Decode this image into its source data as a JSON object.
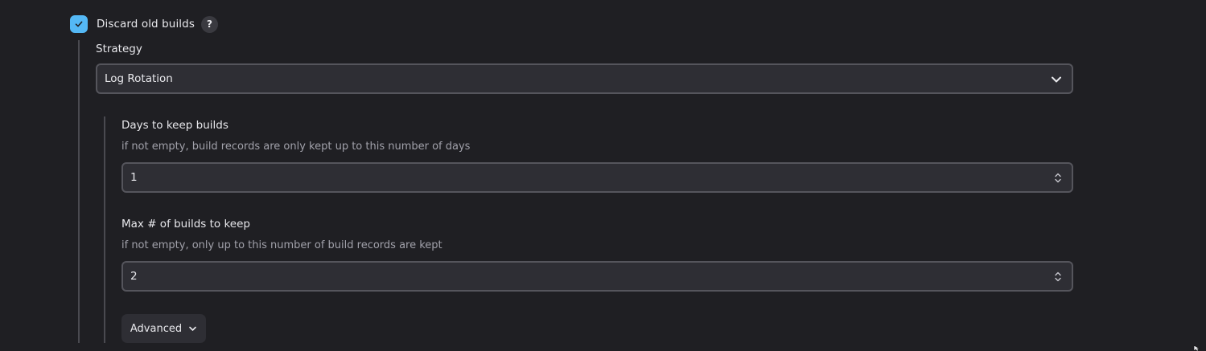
{
  "discard_old_builds": {
    "label": "Discard old builds",
    "checked": true,
    "help_label": "?"
  },
  "strategy": {
    "label": "Strategy",
    "selected": "Log Rotation"
  },
  "days_to_keep": {
    "label": "Days to keep builds",
    "description": "if not empty, build records are only kept up to this number of days",
    "value": "1"
  },
  "max_builds": {
    "label": "Max # of builds to keep",
    "description": "if not empty, only up to this number of build records are kept",
    "value": "2"
  },
  "advanced": {
    "label": "Advanced"
  },
  "colors": {
    "background": "#1f1f23",
    "checkbox_accent": "#54b8f5",
    "field_background": "#2e2e34",
    "field_border": "#55555c"
  },
  "icons": {
    "checkbox": "check-icon",
    "select": "chevron-down-icon",
    "number": "spinner-arrows-icon",
    "advanced": "chevron-down-icon"
  }
}
